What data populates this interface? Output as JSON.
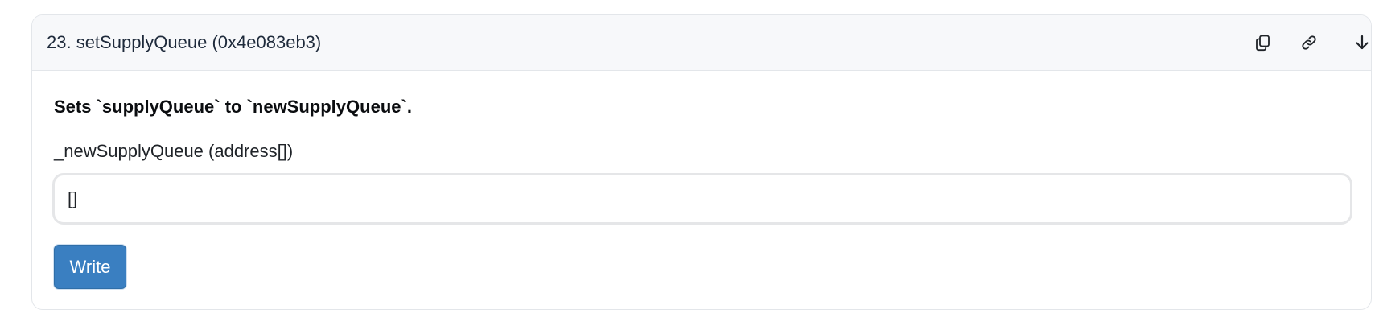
{
  "function": {
    "title": "23. setSupplyQueue (0x4e083eb3)",
    "description": "Sets `supplyQueue` to `newSupplyQueue`.",
    "param_label": "_newSupplyQueue (address[])",
    "param_value": "[]",
    "write_label": "Write"
  },
  "icons": {
    "copy": "copy-icon",
    "link": "link-icon",
    "scroll_down": "arrow-down-icon"
  },
  "colors": {
    "header_bg": "#f7f8fa",
    "write_button": "#3a7fc1",
    "border": "#e3e6ea"
  }
}
